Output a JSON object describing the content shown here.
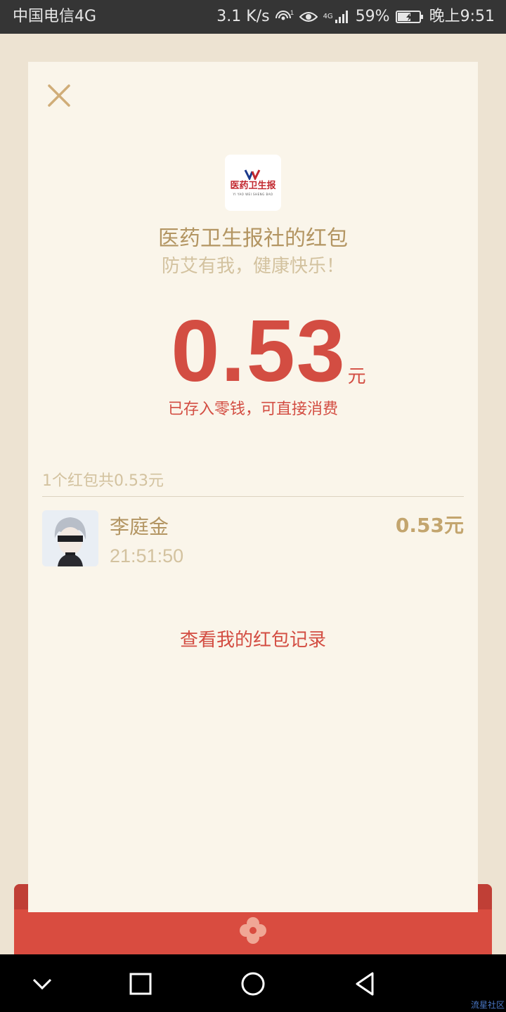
{
  "status_bar": {
    "carrier": "中国电信4G",
    "speed": "3.1 K/s",
    "signal_type": "4G",
    "battery": "59%",
    "time": "晚上9:51"
  },
  "card": {
    "logo_text": "医药卫生报",
    "logo_sub": "YI YAO WEI SHENG BAO",
    "sender_title": "医药卫生报社的红包",
    "greeting": "防艾有我，健康快乐！",
    "amount": "0.53",
    "amount_unit": "元",
    "stored_note": "已存入零钱，可直接消费",
    "summary": "1个红包共0.53元",
    "records": [
      {
        "name": "李庭金",
        "time": "21:51:50",
        "amount": "0.53元"
      }
    ],
    "view_history": "查看我的红包记录"
  },
  "watermark": "流星社区",
  "colors": {
    "accent_red": "#d34d42",
    "gold": "#b39562",
    "card_bg": "#faf5ea",
    "page_bg": "#ede3d2"
  }
}
